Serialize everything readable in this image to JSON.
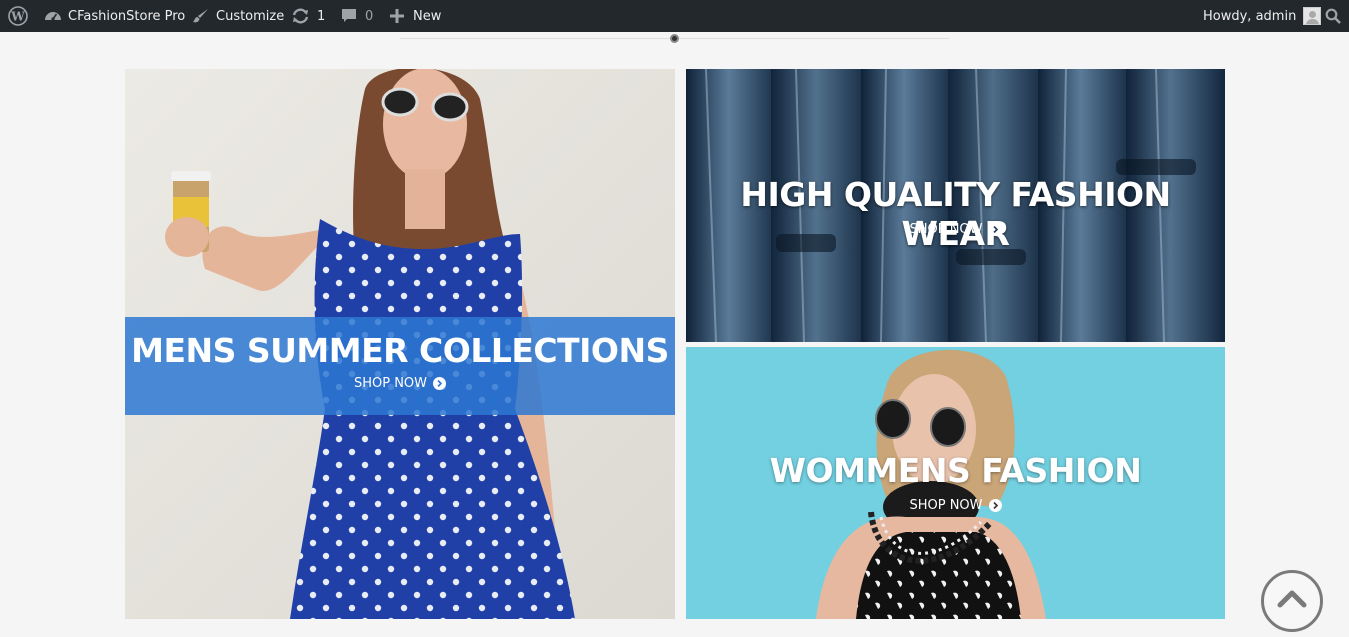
{
  "adminbar": {
    "site_name": "CFashionStore Pro",
    "customize_label": "Customize",
    "updates_count": "1",
    "comments_count": "0",
    "new_label": "New",
    "greeting": "Howdy, admin",
    "icons": [
      "wordpress-icon",
      "dashboard-icon",
      "brush-icon",
      "updates-icon",
      "comment-icon",
      "plus-icon",
      "search-icon"
    ]
  },
  "banners": [
    {
      "title": "MENS SUMMER COLLECTIONS",
      "cta": "SHOP NOW"
    },
    {
      "title": "HIGH QUALITY FASHION WEAR",
      "cta": "SHOP NOW"
    },
    {
      "title": "WOMMENS FASHION",
      "cta": "SHOP NOW"
    }
  ],
  "colors": {
    "adminbar_bg": "#23282d",
    "band_blue": "#2d78d2",
    "denim": "#1c3a5c",
    "aqua": "#6fd0e0"
  }
}
